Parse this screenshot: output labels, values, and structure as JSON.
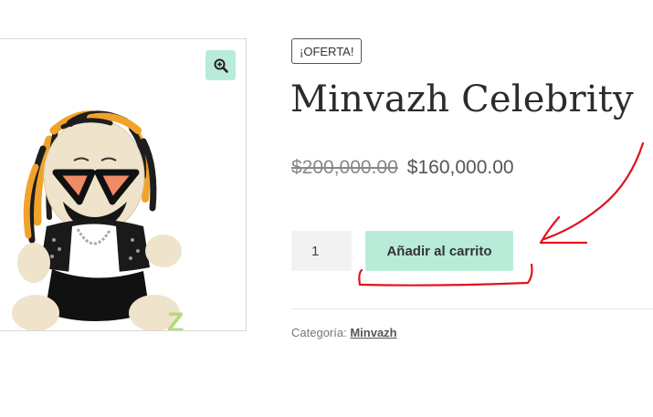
{
  "product": {
    "badge": "¡OFERTA!",
    "title": "Minvazh Celebrity",
    "price_old": "$200,000.00",
    "price_new": "$160,000.00",
    "quantity": "1",
    "add_to_cart_label": "Añadir al carrito",
    "category_label": "Categoría:",
    "category_link": "Minvazh",
    "image_watermark": "Z"
  },
  "icons": {
    "zoom": "zoom-in-icon"
  },
  "colors": {
    "accent": "#b8ecd8",
    "annotation": "#e0141b"
  }
}
